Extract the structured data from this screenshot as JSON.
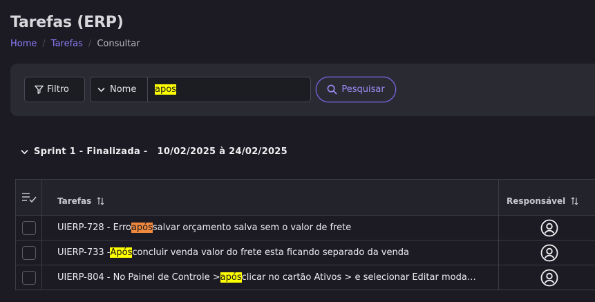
{
  "page": {
    "title": "Tarefas (ERP)"
  },
  "breadcrumb": {
    "items": [
      "Home",
      "Tarefas",
      "Consultar"
    ]
  },
  "filter": {
    "filter_label": "Filtro",
    "field_label": "Nome",
    "search_value": "apos",
    "search_label": "Pesquisar"
  },
  "sprint": {
    "title": "Sprint 1 - Finalizada  -",
    "dates": "10/02/2025 à 24/02/2025"
  },
  "table": {
    "columns": [
      "Tarefas",
      "Responsável"
    ],
    "rows": [
      {
        "before": "UIERP-728 - Erro ",
        "match": "após",
        "after": " salvar orçamento salva sem o valor de frete",
        "highlight": "#f0883e"
      },
      {
        "before": "UIERP-733 - ",
        "match": "Após",
        "after": " concluir venda valor do frete esta ficando separado da venda",
        "highlight": "#ffff00"
      },
      {
        "before": "UIERP-804 - No Painel de Controle > ",
        "match": "após",
        "after": " clicar no cartão Ativos > e selecionar Editar moda…",
        "highlight": "#ffff00"
      }
    ]
  },
  "colors": {
    "accent": "#8b7cf6",
    "background": "#1c1b24",
    "panel": "#2a2a33"
  },
  "icons": [
    "filter-icon",
    "chevron-down-icon",
    "search-icon",
    "checklist-icon",
    "sort-icon",
    "user-circle-icon"
  ]
}
